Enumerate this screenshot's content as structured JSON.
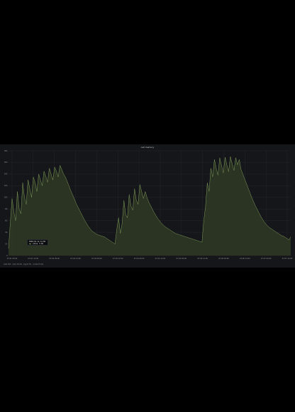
{
  "panel": {
    "title": "cell memory",
    "footer": "Last 24h · max 16.2G · avg 8.7G · current 5.1G"
  },
  "tooltip": {
    "time": "2020-01-14 11:00",
    "series_label": "value",
    "value": "5.6G"
  },
  "colors": {
    "background": "#141619",
    "page": "#000000",
    "line": "#7e9a5a",
    "fill": "#2f3a25",
    "grid": "#23272b",
    "text": "#8e9398"
  },
  "chart_data": {
    "type": "area",
    "title": "cell memory",
    "ylim": [
      0,
      18
    ],
    "yticks": [
      "0",
      "2G",
      "4G",
      "6G",
      "8G",
      "10G",
      "12G",
      "14G",
      "16G",
      "18G"
    ],
    "xticks": [
      "07-01 00:00",
      "07-01 12:00",
      "07-02 00:00",
      "07-02 12:00",
      "07-03 00:00",
      "07-03 12:00",
      "07-04 00:00",
      "07-04 12:00",
      "07-05 00:00",
      "07-05 12:00",
      "07-06 00:00",
      "07-06 12:00",
      "07-07 00:00",
      "07-07 12:00"
    ],
    "grid": true,
    "legend": "none",
    "series": [
      {
        "values": [
          1.2,
          5.6,
          9.8,
          7.5,
          6.0,
          11.0,
          8.0,
          7.2,
          12.5,
          10.0,
          8.8,
          13.0,
          11.5,
          10.0,
          13.5,
          12.5,
          11.0,
          14.0,
          13.0,
          12.0,
          14.5,
          13.6,
          12.6,
          15.0,
          14.0,
          13.0,
          15.2,
          14.5,
          13.5,
          15.5,
          14.8,
          14.0,
          13.5,
          12.8,
          12.0,
          11.2,
          10.5,
          9.8,
          9.0,
          8.4,
          7.8,
          7.2,
          6.6,
          6.0,
          5.5,
          5.0,
          4.6,
          4.2,
          4.0,
          3.8,
          3.6,
          3.5,
          3.4,
          3.3,
          3.2,
          3.0,
          2.8,
          2.6,
          2.4,
          2.2,
          2.0,
          4.5,
          6.5,
          3.8,
          5.5,
          9.5,
          7.0,
          6.5,
          10.5,
          8.5,
          7.8,
          11.5,
          9.5,
          8.8,
          12.2,
          11.0,
          9.8,
          11.0,
          10.0,
          9.2,
          8.6,
          8.0,
          7.4,
          6.9,
          6.4,
          6.0,
          5.6,
          5.3,
          5.0,
          4.8,
          4.6,
          4.4,
          4.2,
          4.0,
          3.8,
          3.7,
          3.6,
          3.5,
          3.4,
          3.3,
          3.2,
          3.1,
          3.0,
          2.9,
          2.8,
          2.7,
          2.6,
          2.5,
          2.4,
          2.3,
          6.0,
          8.5,
          12.5,
          11.0,
          15.0,
          13.5,
          16.5,
          15.0,
          13.8,
          16.8,
          15.5,
          14.2,
          16.9,
          15.6,
          14.4,
          17.0,
          15.8,
          14.6,
          16.8,
          15.6,
          16.5,
          14.8,
          14.0,
          13.2,
          12.4,
          11.6,
          10.8,
          10.0,
          9.3,
          8.6,
          8.0,
          7.4,
          6.8,
          6.3,
          5.8,
          5.4,
          5.1,
          4.8,
          4.6,
          4.4,
          4.2,
          4.0,
          3.8,
          3.6,
          3.4,
          3.3,
          3.1,
          2.9,
          2.7,
          3.2
        ]
      }
    ]
  }
}
